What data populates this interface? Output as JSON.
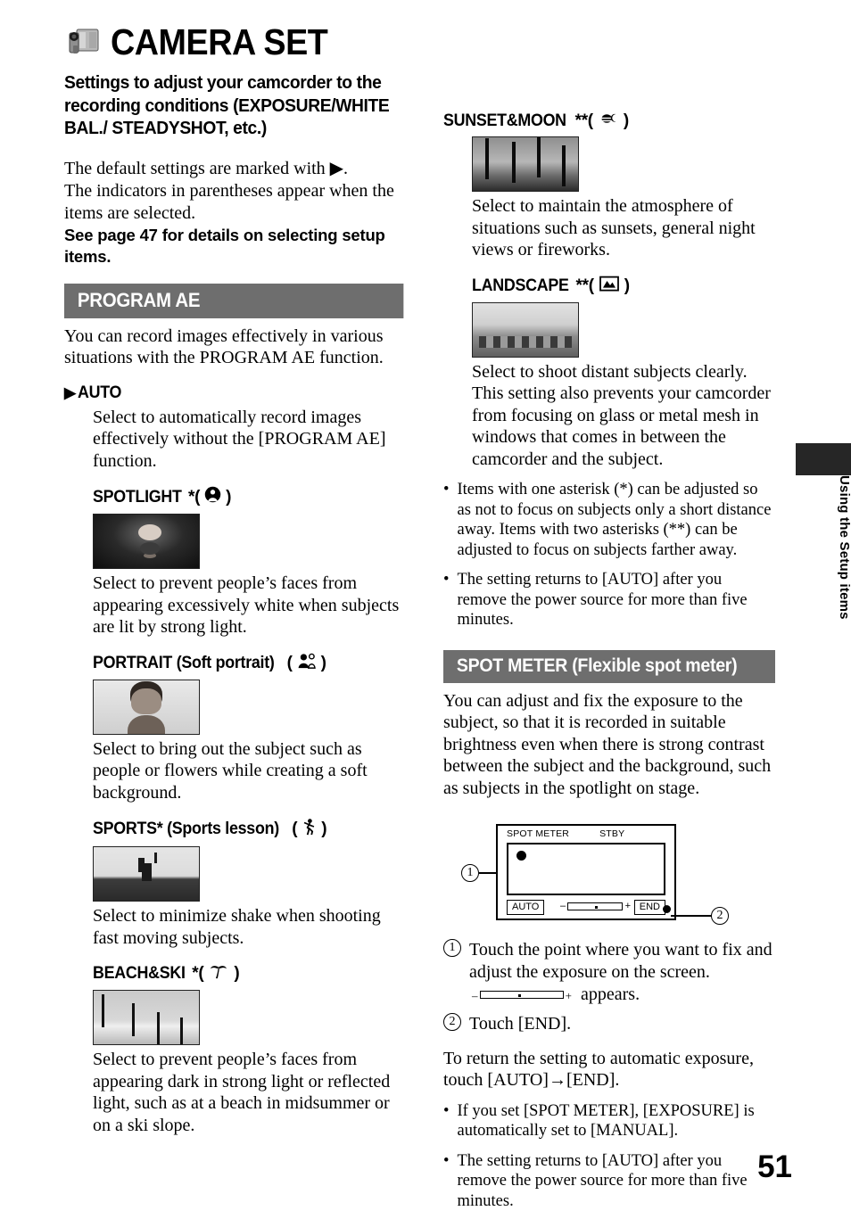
{
  "header": {
    "icon": "camcorder-icon",
    "title": "CAMERA SET",
    "subtitle": "Settings to adjust your camcorder to the recording conditions (EXPOSURE/WHITE BAL./ STEADYSHOT, etc.)"
  },
  "intro": {
    "line1": "The default settings are marked with ▶.",
    "line2": "The indicators in parentheses appear when the items are selected.",
    "bold": "See page 47 for details on selecting setup items."
  },
  "sections": {
    "program_ae": {
      "bar_label": "PROGRAM AE",
      "description": "You can record images effectively in various situations with the PROGRAM AE function.",
      "modes": [
        {
          "default_marker": "▶",
          "name": "AUTO",
          "suffix": "",
          "icon": "",
          "icon_name": "",
          "description": "Select to automatically record images effectively without the [PROGRAM AE] function.",
          "has_thumbnail": false
        },
        {
          "default_marker": "",
          "name": "SPOTLIGHT",
          "suffix": "*(",
          "icon_name": "spotlight-person-icon",
          "close": ")",
          "description": "Select to prevent people’s faces from appearing excessively white when subjects are lit by strong light.",
          "has_thumbnail": true,
          "thumbnail_alt": "woman-in-spotlight-photo"
        },
        {
          "default_marker": "",
          "name": "PORTRAIT (Soft portrait)",
          "suffix": " (",
          "icon_name": "soft-portrait-icon",
          "close": ")",
          "description": "Select to bring out the subject such as people or flowers while creating a soft background.",
          "has_thumbnail": true,
          "thumbnail_alt": "portrait-face-photo"
        },
        {
          "default_marker": "",
          "name": "SPORTS* (Sports lesson)",
          "suffix": " (",
          "icon_name": "running-person-icon",
          "close": ")",
          "description": "Select to minimize shake when shooting fast moving subjects.",
          "has_thumbnail": true,
          "thumbnail_alt": "golfer-swinging-photo"
        },
        {
          "default_marker": "",
          "name": "BEACH&SKI",
          "suffix": "*(",
          "icon_name": "palm-tree-icon",
          "close": ")",
          "description": "Select to prevent people’s faces from appearing dark in strong light or reflected light, such as at a beach in midsummer or on a ski slope.",
          "has_thumbnail": true,
          "thumbnail_alt": "beach-palm-trees-photo"
        },
        {
          "default_marker": "",
          "name": "SUNSET&MOON",
          "suffix": "**(",
          "icon_name": "sunset-moon-icon",
          "close": ")",
          "description": "Select to maintain the atmosphere of situations such as sunsets, general night views or fireworks.",
          "has_thumbnail": true,
          "thumbnail_alt": "sunset-palm-trees-photo"
        },
        {
          "default_marker": "",
          "name": "LANDSCAPE",
          "suffix": "**(",
          "icon_name": "mountain-landscape-icon",
          "close": ")",
          "description": "Select to shoot distant subjects clearly. This setting also prevents your camcorder from focusing on glass or metal mesh in windows that comes in between the camcorder and the subject.",
          "has_thumbnail": true,
          "thumbnail_alt": "bridge-landscape-photo"
        }
      ],
      "notes": [
        "Items with one asterisk (*) can be adjusted so as not to focus on subjects only a short distance away. Items with two asterisks (**) can be adjusted to focus on subjects farther away.",
        "The setting returns to [AUTO] after you remove the power source for more than five minutes."
      ]
    },
    "spot_meter": {
      "bar_label": "SPOT METER (Flexible spot meter)",
      "description": "You can adjust and fix the exposure to the subject, so that it is recorded in suitable brightness even when there is strong contrast between the subject and the background, such as subjects in the spotlight on stage.",
      "diagram": {
        "callout_1": "1",
        "callout_2": "2",
        "screen_label": "SPOT METER",
        "status_label": "STBY",
        "auto_button": "AUTO",
        "end_button": "END"
      },
      "steps": [
        {
          "num": "1",
          "text": "Touch the point where you want to fix and adjust the exposure on the screen."
        },
        {
          "num": "2",
          "text": "Touch [END]."
        }
      ],
      "appears_text": "appears.",
      "return_text": "To return the setting to automatic exposure, touch [AUTO]→[END].",
      "notes": [
        "If you set [SPOT METER], [EXPOSURE] is automatically set to [MANUAL].",
        "The setting returns to [AUTO] after you remove the power source for more than five minutes."
      ]
    }
  },
  "side_tab": {
    "label": "Using the Setup items"
  },
  "page_number": "51",
  "colors": {
    "section_bar": "#6e6e6e",
    "tab_block": "#262626"
  }
}
